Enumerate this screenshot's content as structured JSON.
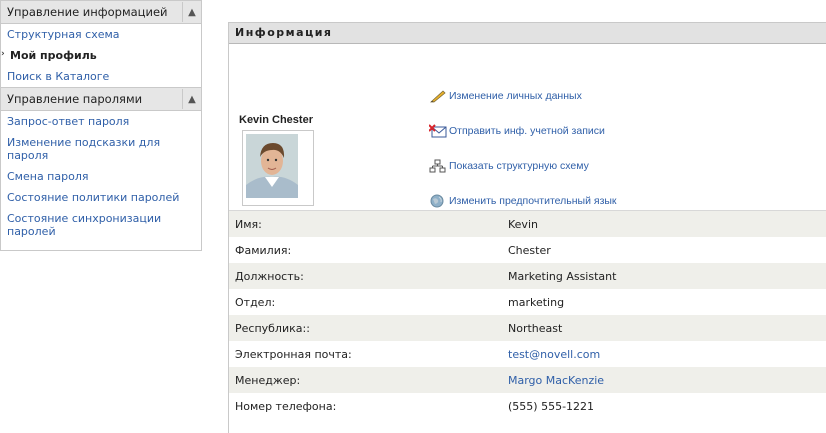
{
  "sidebar": {
    "groups": [
      {
        "title": "Управление информацией",
        "items": [
          {
            "label": "Структурная схема"
          },
          {
            "label": "Мой профиль"
          },
          {
            "label": "Поиск в Каталоге"
          }
        ]
      },
      {
        "title": "Управление паролями",
        "items": [
          {
            "label": "Запрос-ответ пароля"
          },
          {
            "label": "Изменение подсказки для пароля"
          },
          {
            "label": "Смена пароля"
          },
          {
            "label": "Состояние политики паролей"
          },
          {
            "label": "Состояние синхронизации паролей"
          }
        ]
      }
    ],
    "active_item": "Мой профиль"
  },
  "panel": {
    "title": "Информация",
    "user_name": "Kevin Chester",
    "actions": [
      {
        "label": "Изменение личных данных",
        "icon": "pencil-icon"
      },
      {
        "label": "Отправить инф. учетной записи",
        "icon": "mail-icon"
      },
      {
        "label": "Показать структурную схему",
        "icon": "org-chart-icon"
      },
      {
        "label": "Изменить предпочтительный язык",
        "icon": "globe-icon"
      }
    ],
    "attributes": [
      {
        "label": "Имя:",
        "value": "Kevin"
      },
      {
        "label": "Фамилия:",
        "value": "Chester"
      },
      {
        "label": "Должность:",
        "value": "Marketing Assistant"
      },
      {
        "label": "Отдел:",
        "value": "marketing"
      },
      {
        "label": "Республика::",
        "value": "Northeast"
      },
      {
        "label": "Электронная почта:",
        "value": "test@novell.com"
      },
      {
        "label": "Менеджер:",
        "value": "Margo MacKenzie"
      },
      {
        "label": "Номер телефона:",
        "value": "(555) 555-1221"
      }
    ]
  },
  "colors": {
    "link": "#2f5fa8",
    "header_bg": "#e6e6e6",
    "row_alt": "#efefea"
  }
}
